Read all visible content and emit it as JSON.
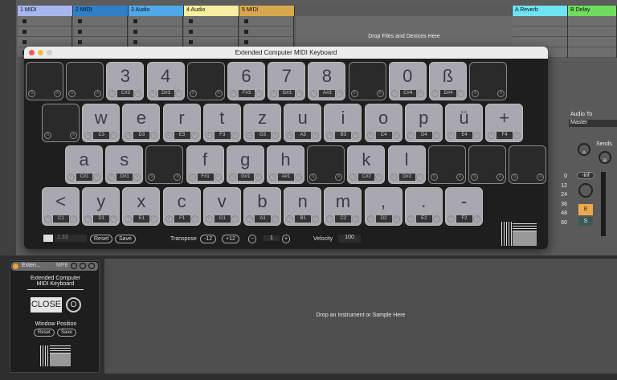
{
  "tracks": [
    {
      "name": "1 MIDI",
      "color": "#a7b6f0"
    },
    {
      "name": "2 MIDI",
      "color": "#2f7fc9"
    },
    {
      "name": "3 Audio",
      "color": "#4fa8e8"
    },
    {
      "name": "4 Audio",
      "color": "#f7efa0"
    },
    {
      "name": "5 MIDI",
      "color": "#d9a84e"
    }
  ],
  "returns": [
    {
      "name": "A Reverb",
      "color": "#6fe4f2"
    },
    {
      "name": "B Delay",
      "color": "#6fdc5e"
    }
  ],
  "drop_files": "Drop Files and Devices Here",
  "mixer": {
    "audio_to_label": "Audio To",
    "audio_to_value": "Master",
    "sends_label": "Sends",
    "send_a": "A",
    "send_b": "B",
    "volume": "-inf",
    "solo": "S",
    "record": "B",
    "db_scale": [
      "0",
      "12",
      "24",
      "36",
      "48",
      "60"
    ]
  },
  "window": {
    "title": "Extended Computer MIDI Keyboard"
  },
  "rows": [
    [
      {
        "k": "",
        "n": ""
      },
      {
        "k": "",
        "n": ""
      },
      {
        "k": "3",
        "n": "C#3"
      },
      {
        "k": "4",
        "n": "D#3"
      },
      {
        "k": "",
        "n": ""
      },
      {
        "k": "6",
        "n": "F#3"
      },
      {
        "k": "7",
        "n": "G#3"
      },
      {
        "k": "8",
        "n": "A#3"
      },
      {
        "k": "",
        "n": ""
      },
      {
        "k": "0",
        "n": "C#4"
      },
      {
        "k": "ß",
        "n": "D#4"
      },
      {
        "k": "",
        "n": ""
      }
    ],
    [
      {
        "k": "",
        "n": ""
      },
      {
        "k": "w",
        "n": "C3"
      },
      {
        "k": "e",
        "n": "D3"
      },
      {
        "k": "r",
        "n": "E3"
      },
      {
        "k": "t",
        "n": "F3"
      },
      {
        "k": "z",
        "n": "G3"
      },
      {
        "k": "u",
        "n": "A3"
      },
      {
        "k": "i",
        "n": "B3"
      },
      {
        "k": "o",
        "n": "C4"
      },
      {
        "k": "p",
        "n": "D4"
      },
      {
        "k": "ü",
        "n": "E4"
      },
      {
        "k": "+",
        "n": "F4"
      }
    ],
    [
      {
        "k": "a",
        "n": "C#1"
      },
      {
        "k": "s",
        "n": "D#1"
      },
      {
        "k": "",
        "n": ""
      },
      {
        "k": "f",
        "n": "F#1"
      },
      {
        "k": "g",
        "n": "G#1"
      },
      {
        "k": "h",
        "n": "A#1"
      },
      {
        "k": "",
        "n": ""
      },
      {
        "k": "k",
        "n": "C#2"
      },
      {
        "k": "l",
        "n": "D#2"
      },
      {
        "k": "",
        "n": ""
      },
      {
        "k": "",
        "n": ""
      },
      {
        "k": "",
        "n": ""
      }
    ],
    [
      {
        "k": "<",
        "n": "C1"
      },
      {
        "k": "y",
        "n": "D1"
      },
      {
        "k": "x",
        "n": "E1"
      },
      {
        "k": "c",
        "n": "F1"
      },
      {
        "k": "v",
        "n": "G1"
      },
      {
        "k": "b",
        "n": "A1"
      },
      {
        "k": "n",
        "n": "B1"
      },
      {
        "k": "m",
        "n": "C2"
      },
      {
        "k": ",",
        "n": "D2"
      },
      {
        "k": ".",
        "n": "E2"
      },
      {
        "k": "-",
        "n": "F2"
      }
    ]
  ],
  "key_solo": "S",
  "key_close": "X",
  "footer": {
    "scale": "1.33",
    "reset": "Reset",
    "save": "Save",
    "transpose_label": "Transpose",
    "minus12": "-12",
    "plus12": "+12",
    "octave": "1",
    "velocity_label": "Velocity",
    "velocity": "100"
  },
  "device": {
    "name": "Exten...",
    "mpe": "MPE",
    "title": "Extended Computer MIDI  Keyboard",
    "close": "CLOSE",
    "toggle": "O",
    "window_position": "Window Position",
    "reset": "Reset",
    "save": "Save"
  },
  "drop_instrument": "Drop an Instrument or Sample Here"
}
